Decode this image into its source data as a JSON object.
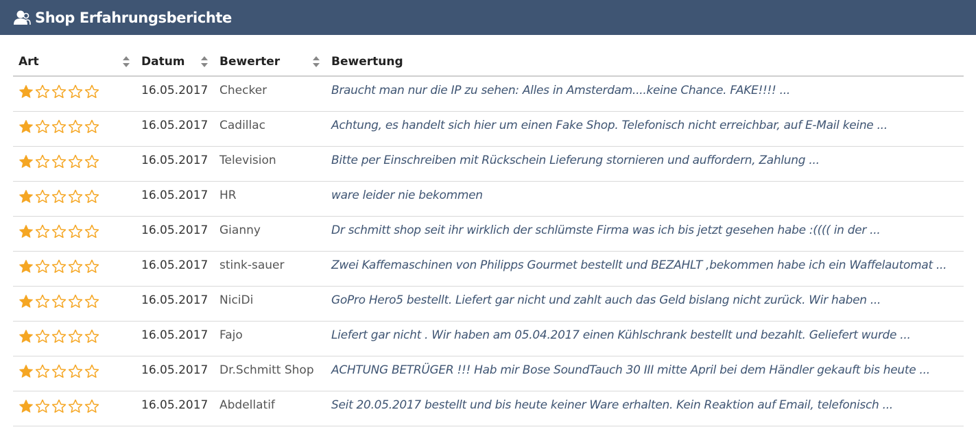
{
  "header": {
    "title": "Shop Erfahrungsberichte",
    "icon": "users-icon"
  },
  "table": {
    "columns": [
      {
        "label": "Art",
        "sortable": true
      },
      {
        "label": "Datum",
        "sortable": true
      },
      {
        "label": "Bewerter",
        "sortable": true
      },
      {
        "label": "Bewertung",
        "sortable": false
      }
    ],
    "rows": [
      {
        "rating": 1,
        "date": "16.05.2017",
        "user": "Checker",
        "text": "Braucht man nur die IP zu sehen: Alles in Amsterdam....keine Chance. FAKE!!!! ..."
      },
      {
        "rating": 1,
        "date": "16.05.2017",
        "user": "Cadillac",
        "text": "Achtung, es handelt sich hier um einen Fake Shop. Telefonisch nicht erreichbar, auf E-Mail keine ..."
      },
      {
        "rating": 1,
        "date": "16.05.2017",
        "user": "Television",
        "text": "Bitte per Einschreiben mit Rückschein Lieferung stornieren und auffordern, Zahlung ..."
      },
      {
        "rating": 1,
        "date": "16.05.2017",
        "user": "HR",
        "text": "ware leider nie bekommen"
      },
      {
        "rating": 1,
        "date": "16.05.2017",
        "user": "Gianny",
        "text": "Dr schmitt shop seit ihr wirklich der schlümste Firma was ich bis jetzt gesehen habe :(((( in der ..."
      },
      {
        "rating": 1,
        "date": "16.05.2017",
        "user": "stink-sauer",
        "text": "Zwei Kaffemaschinen von Philipps Gourmet bestellt und BEZAHLT ,bekommen habe ich ein Waffelautomat ..."
      },
      {
        "rating": 1,
        "date": "16.05.2017",
        "user": "NiciDi",
        "text": "GoPro Hero5 bestellt. Liefert gar nicht und zahlt auch das Geld bislang nicht zurück. Wir haben ..."
      },
      {
        "rating": 1,
        "date": "16.05.2017",
        "user": "Fajo",
        "text": "Liefert gar nicht . Wir haben am 05.04.2017 einen Kühlschrank bestellt und bezahlt. Geliefert wurde ..."
      },
      {
        "rating": 1,
        "date": "16.05.2017",
        "user": "Dr.Schmitt Shop",
        "text": "ACHTUNG BETRÜGER !!! Hab mir Bose SoundTauch 30 III mitte April bei dem Händler gekauft bis heute ..."
      },
      {
        "rating": 1,
        "date": "16.05.2017",
        "user": "Abdellatif",
        "text": "Seit 20.05.2017 bestellt und bis heute keiner Ware erhalten. Kein Reaktion auf Email, telefonisch ..."
      }
    ],
    "max_rating": 5
  },
  "colors": {
    "header_bg": "#3f5573",
    "star": "#f5a623",
    "review_text": "#3f5573"
  }
}
